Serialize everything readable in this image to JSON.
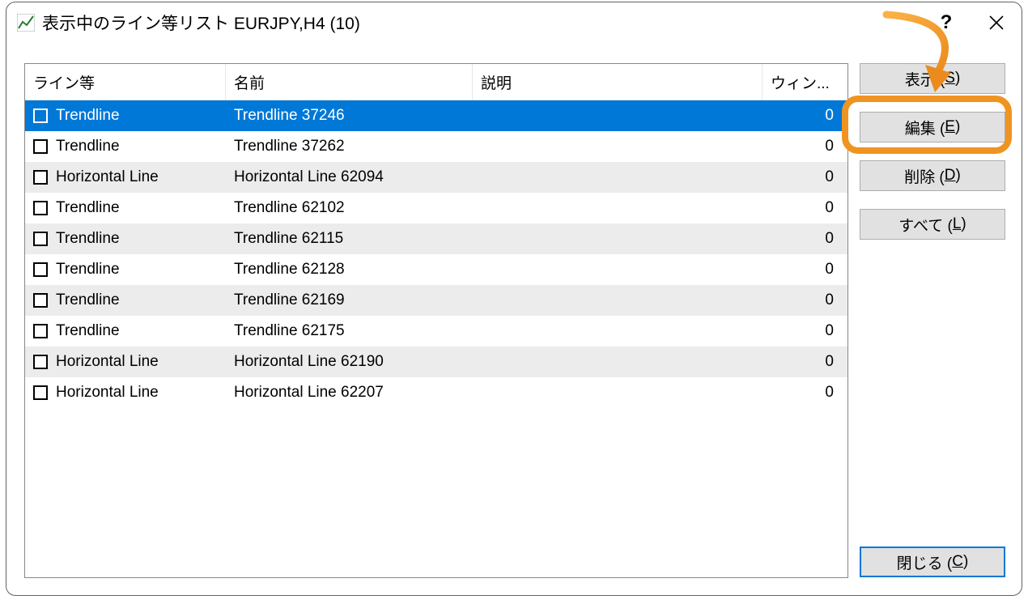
{
  "titlebar": {
    "title": "表示中のライン等リスト EURJPY,H4 (10)",
    "help": "?",
    "close": "×"
  },
  "headers": {
    "type": "ライン等",
    "name": "名前",
    "desc": "説明",
    "win": "ウィン..."
  },
  "rows": [
    {
      "type": "Trendline",
      "name": "Trendline 37246",
      "desc": "",
      "win": "0",
      "selected": true
    },
    {
      "type": "Trendline",
      "name": "Trendline 37262",
      "desc": "",
      "win": "0",
      "selected": false
    },
    {
      "type": "Horizontal Line",
      "name": "Horizontal Line 62094",
      "desc": "",
      "win": "0",
      "selected": false
    },
    {
      "type": "Trendline",
      "name": "Trendline 62102",
      "desc": "",
      "win": "0",
      "selected": false
    },
    {
      "type": "Trendline",
      "name": "Trendline 62115",
      "desc": "",
      "win": "0",
      "selected": false
    },
    {
      "type": "Trendline",
      "name": "Trendline 62128",
      "desc": "",
      "win": "0",
      "selected": false
    },
    {
      "type": "Trendline",
      "name": "Trendline 62169",
      "desc": "",
      "win": "0",
      "selected": false
    },
    {
      "type": "Trendline",
      "name": "Trendline 62175",
      "desc": "",
      "win": "0",
      "selected": false
    },
    {
      "type": "Horizontal Line",
      "name": "Horizontal Line 62190",
      "desc": "",
      "win": "0",
      "selected": false
    },
    {
      "type": "Horizontal Line",
      "name": "Horizontal Line 62207",
      "desc": "",
      "win": "0",
      "selected": false
    }
  ],
  "buttons": {
    "show": {
      "text": "表示 (",
      "accel": "S",
      "suffix": ")"
    },
    "edit": {
      "text": "編集 (",
      "accel": "E",
      "suffix": ")"
    },
    "delete": {
      "text": "削除 (",
      "accel": "D",
      "suffix": ")"
    },
    "all": {
      "text": "すべて (",
      "accel": "L",
      "suffix": ")"
    },
    "close": {
      "text": "閉じる (",
      "accel": "C",
      "suffix": ")"
    }
  }
}
